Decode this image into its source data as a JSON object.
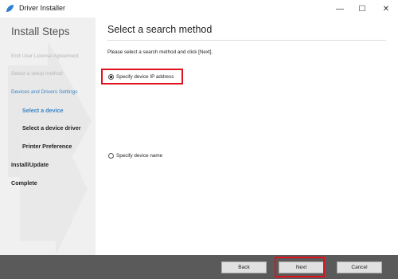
{
  "window": {
    "title": "Driver Installer",
    "controls": {
      "minimize": "—",
      "maximize": "☐",
      "close": "✕"
    }
  },
  "sidebar": {
    "title": "Install Steps",
    "steps": [
      {
        "label": "End User License Agreement",
        "state": "completed"
      },
      {
        "label": "Select a setup method",
        "state": "completed"
      },
      {
        "label": "Devices and Drivers Settings",
        "state": "current-group"
      },
      {
        "label": "Select a device",
        "state": "current"
      },
      {
        "label": "Select a device driver",
        "state": "pending"
      },
      {
        "label": "Printer Preference",
        "state": "pending"
      },
      {
        "label": "Install/Update",
        "state": "pending"
      },
      {
        "label": "Complete",
        "state": "pending"
      }
    ]
  },
  "main": {
    "title": "Select a search method",
    "instruction": "Please select a search method and click [Next].",
    "options": [
      {
        "label": "Specify device IP address",
        "selected": true
      },
      {
        "label": "Specify device name",
        "selected": false
      }
    ]
  },
  "footer": {
    "back_label": "Back",
    "next_label": "Next",
    "cancel_label": "Cancel"
  },
  "colors": {
    "accent": "#3b86c6",
    "highlight": "#e0121e",
    "footer": "#5a5a5a",
    "sidebar": "#f0f0f0"
  }
}
